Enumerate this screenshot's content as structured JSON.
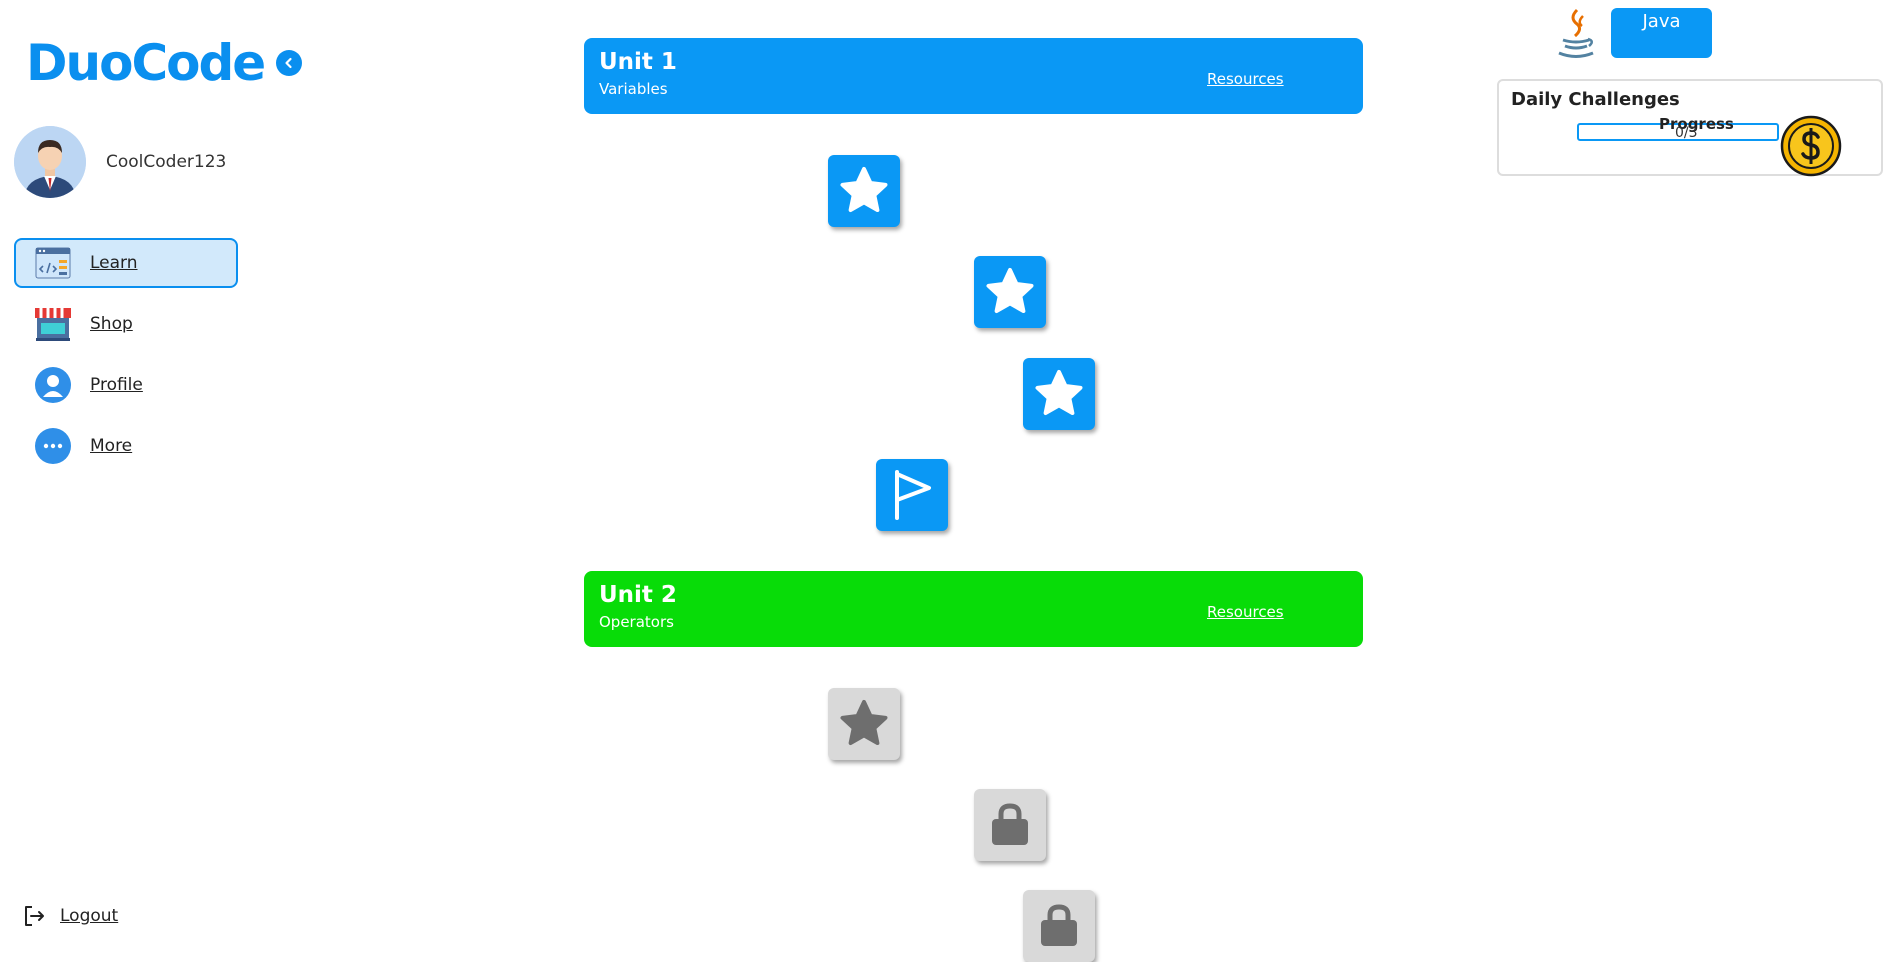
{
  "app": {
    "name": "DuoCode"
  },
  "user": {
    "username": "CoolCoder123"
  },
  "sidebar": {
    "items": [
      {
        "label": "Learn",
        "icon": "code-window-icon",
        "active": true
      },
      {
        "label": "Shop",
        "icon": "storefront-icon",
        "active": false
      },
      {
        "label": "Profile",
        "icon": "profile-icon",
        "active": false
      },
      {
        "label": "More",
        "icon": "more-dots-icon",
        "active": false
      }
    ],
    "logout_label": "Logout"
  },
  "units": [
    {
      "title": "Unit 1",
      "subtitle": "Variables",
      "resources_label": "Resources",
      "color": "#0a98f5"
    },
    {
      "title": "Unit 2",
      "subtitle": "Operators",
      "resources_label": "Resources",
      "color": "#08dc08"
    }
  ],
  "lessons": [
    {
      "unit": 1,
      "status": "completed",
      "icon": "star-icon"
    },
    {
      "unit": 1,
      "status": "completed",
      "icon": "star-icon"
    },
    {
      "unit": 1,
      "status": "completed",
      "icon": "star-icon"
    },
    {
      "unit": 1,
      "status": "completed",
      "icon": "flag-icon"
    },
    {
      "unit": 2,
      "status": "available",
      "icon": "star-icon"
    },
    {
      "unit": 2,
      "status": "locked",
      "icon": "lock-icon"
    },
    {
      "unit": 2,
      "status": "locked",
      "icon": "lock-icon"
    }
  ],
  "language": {
    "selected": "Java",
    "icon": "java-logo-icon"
  },
  "daily_challenges": {
    "title": "Daily Challenges",
    "progress_label": "Progress",
    "progress_text": "0/3",
    "progress_fraction": 0,
    "reward_icon": "coin-icon"
  },
  "colors": {
    "accent": "#0a98f5",
    "unit2": "#08dc08",
    "locked": "#d9d9d9"
  }
}
